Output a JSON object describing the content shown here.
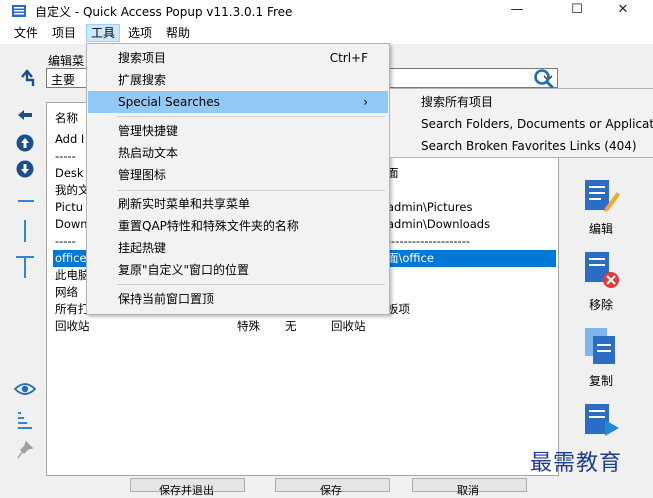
{
  "window": {
    "title": "自定义 - Quick Access Popup v11.3.0.1 Free",
    "minimize_glyph": "—",
    "maximize_glyph": "☐",
    "close_glyph": "✕"
  },
  "menubar": {
    "items": [
      "文件",
      "项目",
      "工具",
      "选项",
      "帮助"
    ]
  },
  "edit_menu_label": "编辑菜",
  "menu_select_value": "主要",
  "list": {
    "header_name": "名称",
    "rows": [
      {
        "name": "Add I",
        "extra": ""
      },
      {
        "name": "-----",
        "extra": ""
      },
      {
        "name": "Desk",
        "extra": "面"
      },
      {
        "name": "我的文",
        "extra": ""
      },
      {
        "name": "Pictu",
        "extra": "admin\\Pictures"
      },
      {
        "name": "Down",
        "extra": "admin\\Downloads"
      },
      {
        "name": "-----",
        "extra": "--------------------"
      },
      {
        "name": "office",
        "extra": "面\\office"
      },
      {
        "name": "此电脑",
        "extra": ""
      },
      {
        "name": "网络",
        "extra": ""
      },
      {
        "name": "所有打",
        "extra": "板项"
      },
      {
        "name": "回收站",
        "extra": ""
      }
    ],
    "recycle_row": {
      "type": "特殊",
      "hotkey": "无",
      "location": "回收站"
    }
  },
  "tools_menu": {
    "items": [
      {
        "label": "搜索项目",
        "shortcut": "Ctrl+F"
      },
      {
        "label": "扩展搜索",
        "shortcut": ""
      },
      {
        "label": "Special Searches",
        "shortcut": "›"
      },
      {
        "label": "管理快捷键",
        "shortcut": ""
      },
      {
        "label": "热启动文本",
        "shortcut": ""
      },
      {
        "label": "管理图标",
        "shortcut": ""
      },
      {
        "label": "刷新实时菜单和共享菜单",
        "shortcut": ""
      },
      {
        "label": "重置QAP特性和特殊文件夹的名称",
        "shortcut": ""
      },
      {
        "label": "挂起热键",
        "shortcut": ""
      },
      {
        "label": "复原\"自定义\"窗口的位置",
        "shortcut": ""
      },
      {
        "label": "保持当前窗口置顶",
        "shortcut": ""
      }
    ]
  },
  "special_searches_submenu": {
    "items": [
      "搜索所有项目",
      "Search Folders, Documents or Applications",
      "Search Broken Favorites Links (404)"
    ]
  },
  "right_panel": {
    "edit_label": "编辑",
    "remove_label": "移除",
    "copy_label": "复制"
  },
  "bottom_buttons": [
    "保存并退出",
    "保存",
    "取消"
  ],
  "watermark": "最需教育",
  "colors": {
    "accent": "#0078d7",
    "menu_highlight": "#91c9f7",
    "selection": "#0078d7",
    "remove_red": "#e53935"
  }
}
